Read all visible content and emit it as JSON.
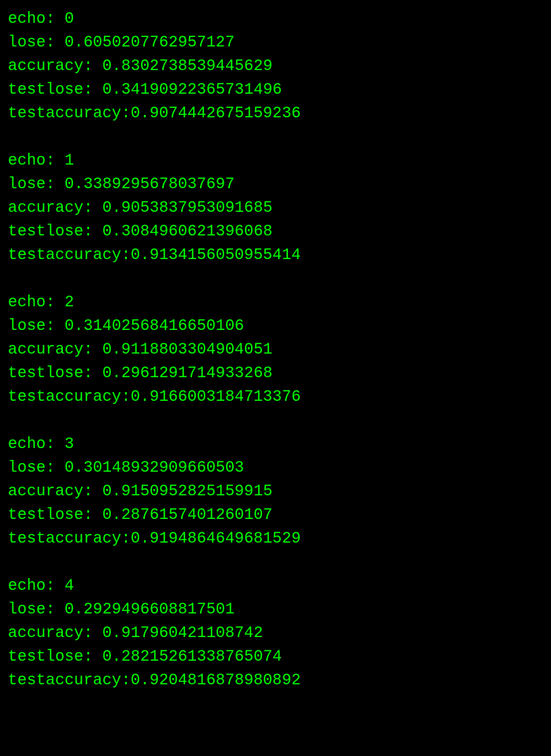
{
  "epochs": [
    {
      "echo_label": "echo: ",
      "echo_value": "0",
      "lose_label": "lose: ",
      "lose_value": "0.6050207762957127",
      "accuracy_label": "accuracy: ",
      "accuracy_value": "0.8302738539445629",
      "testlose_label": "testlose: ",
      "testlose_value": "0.34190922365731496",
      "testaccuracy_label": "testaccuracy:",
      "testaccuracy_value": "0.9074442675159236"
    },
    {
      "echo_label": "echo: ",
      "echo_value": "1",
      "lose_label": "lose: ",
      "lose_value": "0.3389295678037697",
      "accuracy_label": "accuracy: ",
      "accuracy_value": "0.9053837953091685",
      "testlose_label": "testlose: ",
      "testlose_value": "0.3084960621396068",
      "testaccuracy_label": "testaccuracy:",
      "testaccuracy_value": "0.9134156050955414"
    },
    {
      "echo_label": "echo: ",
      "echo_value": "2",
      "lose_label": "lose: ",
      "lose_value": "0.31402568416650106",
      "accuracy_label": "accuracy: ",
      "accuracy_value": "0.9118803304904051",
      "testlose_label": "testlose: ",
      "testlose_value": "0.2961291714933268",
      "testaccuracy_label": "testaccuracy:",
      "testaccuracy_value": "0.9166003184713376"
    },
    {
      "echo_label": "echo: ",
      "echo_value": "3",
      "lose_label": "lose: ",
      "lose_value": "0.30148932909660503",
      "accuracy_label": "accuracy: ",
      "accuracy_value": "0.9150952825159915",
      "testlose_label": "testlose: ",
      "testlose_value": "0.2876157401260107",
      "testaccuracy_label": "testaccuracy:",
      "testaccuracy_value": "0.9194864649681529"
    },
    {
      "echo_label": "echo: ",
      "echo_value": "4",
      "lose_label": "lose: ",
      "lose_value": "0.2929496608817501",
      "accuracy_label": "accuracy: ",
      "accuracy_value": "0.917960421108742",
      "testlose_label": "testlose: ",
      "testlose_value": "0.28215261338765074",
      "testaccuracy_label": "testaccuracy:",
      "testaccuracy_value": "0.9204816878980892"
    }
  ]
}
